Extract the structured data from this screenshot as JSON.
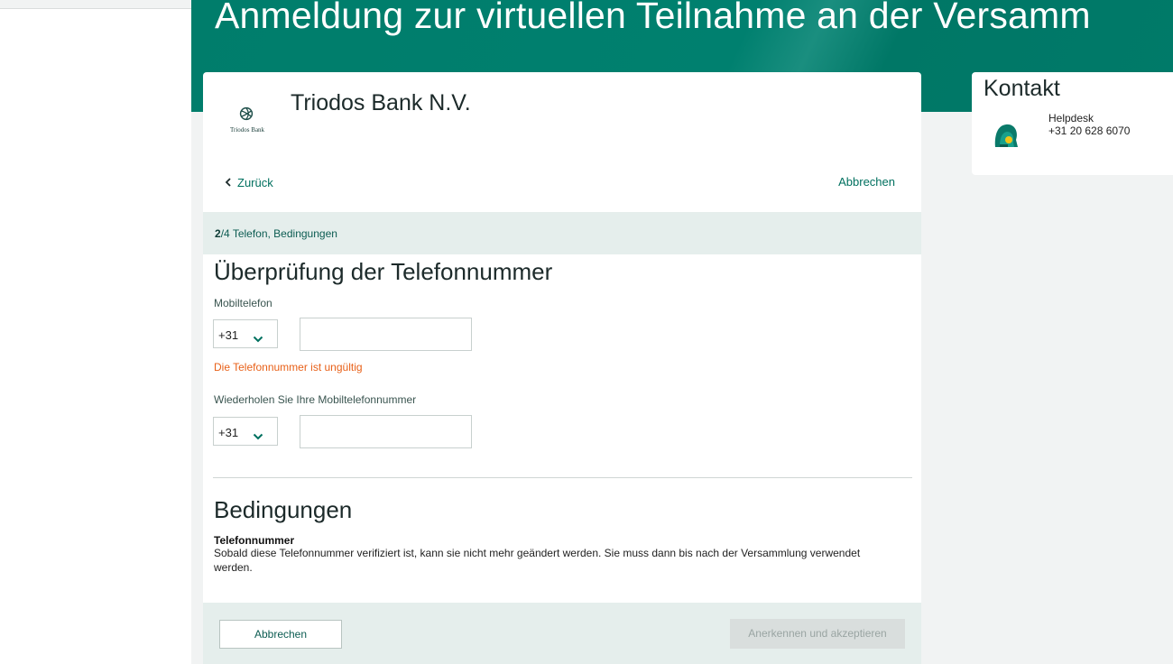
{
  "hero": {
    "title": "Anmeldung zur virtuellen Teilnahme an der Versamm"
  },
  "company": {
    "name": "Triodos Bank N.V.",
    "logo_text": "Triodos Bank"
  },
  "nav": {
    "back_label": "Zurück",
    "cancel_label": "Abbrechen"
  },
  "step": {
    "current": "2",
    "total_suffix": "/4 Telefon, Bedingungen"
  },
  "phone_section": {
    "title": "Überprüfung der Telefonnummer",
    "mobile_label": "Mobiltelefon",
    "mobile_country_code": "+31",
    "mobile_value": "",
    "error": "Die Telefonnummer ist ungültig",
    "repeat_label": "Wiederholen Sie Ihre Mobiltelefonnummer",
    "repeat_country_code": "+31",
    "repeat_value": ""
  },
  "conditions": {
    "title": "Bedingungen",
    "heading": "Telefonnummer",
    "body": "Sobald diese Telefonnummer verifiziert ist, kann sie nicht mehr geändert werden. Sie muss dann bis nach der Versammlung verwendet werden."
  },
  "footer": {
    "cancel_label": "Abbrechen",
    "accept_label": "Anerkennen und akzeptieren"
  },
  "contact": {
    "title": "Kontakt",
    "helpdesk_name": "Helpdesk",
    "helpdesk_phone": "+31 20 628 6070"
  },
  "colors": {
    "brand": "#007d6b",
    "link": "#00705f",
    "error": "#e86018",
    "panel_tint": "#e5eeec"
  },
  "icons": {
    "back": "chevron-left-icon",
    "dropdown": "chevron-down-icon",
    "helpdesk": "helpdesk-avatar-icon",
    "logo": "triodos-logo"
  }
}
